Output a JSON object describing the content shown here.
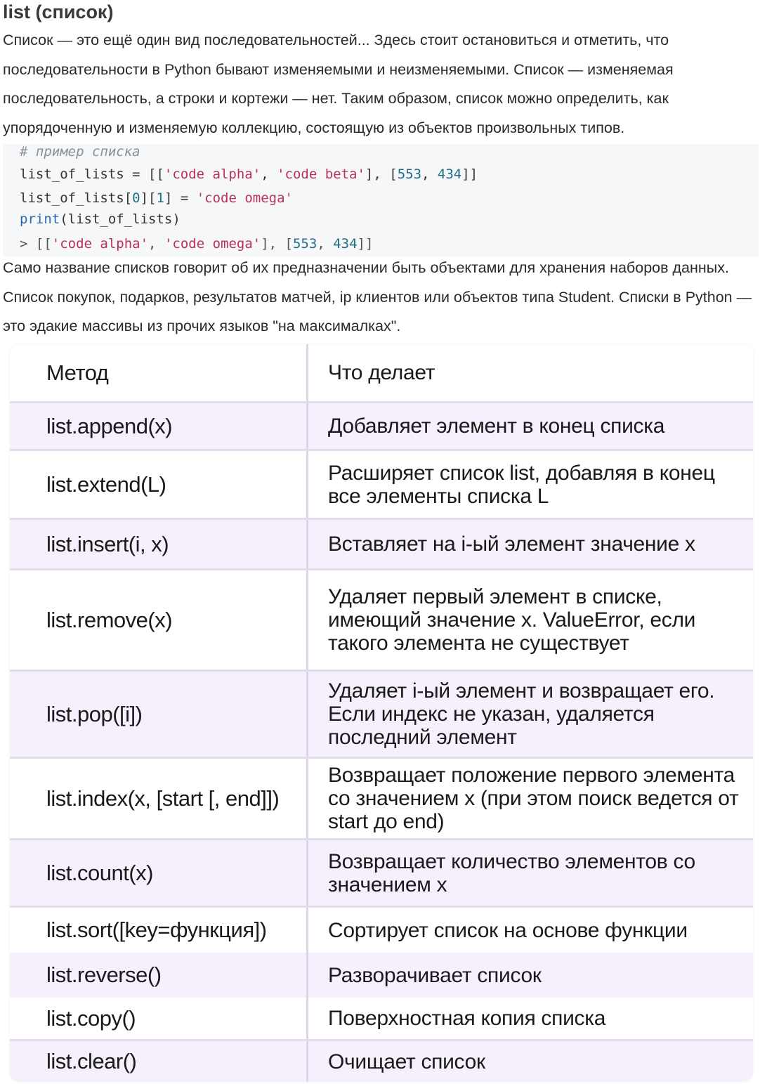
{
  "title": "list (список)",
  "intro": "Список — это ещё один вид последовательностей... Здесь стоит остановиться и отметить, что последовательности в Python бывают изменяемыми и неизменяемыми. Список — изменяемая последовательность, а строки и кортежи — нет. Таким образом, список можно определить, как упорядоченную и изменяемую коллекцию, состоящую из объектов произвольных типов.",
  "code": {
    "comment": "# пример списка",
    "l1_a": "list_of_lists = [[",
    "l1_s1": "'code alpha'",
    "l1_c": ", ",
    "l1_s2": "'code beta'",
    "l1_b": "], [",
    "l1_n1": "553",
    "l1_n2": "434",
    "l1_e": "]]",
    "l2_a": "list_of_lists[",
    "l2_n0": "0",
    "l2_m": "][",
    "l2_n1": "1",
    "l2_b": "] = ",
    "l2_s": "'code omega'",
    "l3_kw": "print",
    "l3_rest": "(list_of_lists)",
    "l4_a": "> [[",
    "l4_s1": "'code alpha'",
    "l4_c": ", ",
    "l4_s2": "'code omega'",
    "l4_b": "], [",
    "l4_n1": "553",
    "l4_n2": "434",
    "l4_e": "]]"
  },
  "outro": "Само название списков говорит об их предназначении быть объектами для хранения наборов данных. Список покупок, подарков, результатов матчей, ip клиентов или объектов типа Student. Списки в Python — это эдакие массивы из прочих языков \"на максималках\".",
  "table": {
    "header": {
      "method": "Метод",
      "desc": "Что делает"
    },
    "rows": [
      {
        "method": "list.append(x)",
        "desc": "Добавляет элемент в конец списка"
      },
      {
        "method": "list.extend(L)",
        "desc": "Расширяет список list, добавляя в конец все элементы списка L"
      },
      {
        "method": "list.insert(i, x)",
        "desc": "Вставляет на i-ый элемент значение x"
      },
      {
        "method": "list.remove(x)",
        "desc": "Удаляет первый элемент в списке, имеющий значение x. ValueError, если такого элемента не существует"
      },
      {
        "method": "list.pop([i])",
        "desc": "Удаляет i-ый элемент и возвращает его. Если индекс не указан, удаляется последний элемент"
      },
      {
        "method": "list.index(x, [start [, end]])",
        "desc": "Возвращает положение первого элемента со значением x (при этом поиск ведется от start до end)"
      },
      {
        "method": "list.count(x)",
        "desc": "Возвращает количество элементов со значением x"
      },
      {
        "method": "list.sort([key=функция])",
        "desc": "Сортирует список на основе функции"
      },
      {
        "method": "list.reverse()",
        "desc": "Разворачивает список"
      },
      {
        "method": "list.copy()",
        "desc": "Поверхностная копия списка"
      },
      {
        "method": "list.clear()",
        "desc": "Очищает список"
      }
    ]
  }
}
